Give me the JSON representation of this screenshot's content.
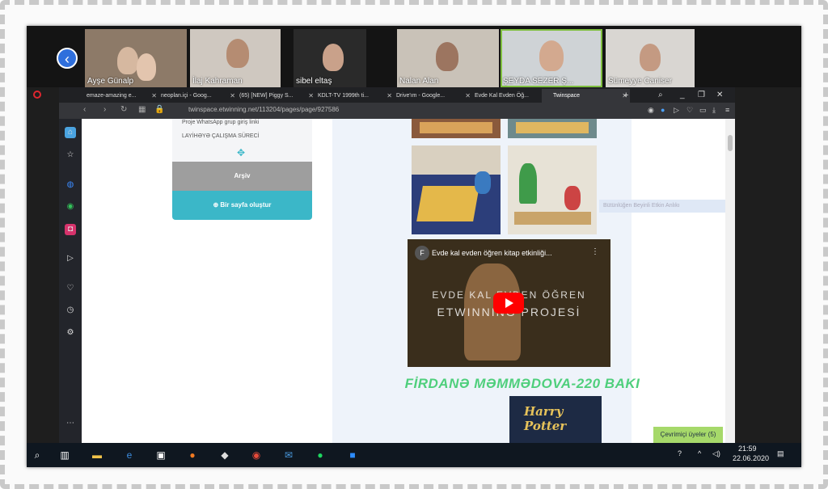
{
  "participants": [
    {
      "name": "Ayşe Günalp"
    },
    {
      "name": "İlaj Kahraman"
    },
    {
      "name": "sibel eltaş"
    },
    {
      "name": "Nalan Alan"
    },
    {
      "name": "ŞEYDA SEZER Ş..."
    },
    {
      "name": "Sümeyye Caniser"
    }
  ],
  "browser": {
    "tabs": [
      {
        "label": "emaze-amazing e..."
      },
      {
        "label": "neoplan.içi - Goog..."
      },
      {
        "label": "(65) [NEW] Piggy S..."
      },
      {
        "label": "KDLT-TV 1999th ti..."
      },
      {
        "label": "Drive'ım - Google..."
      },
      {
        "label": "Evde Kal Evden Öğ..."
      },
      {
        "label": "Twinspace"
      }
    ],
    "new_tab": "+",
    "url": "twinspace.etwinning.net/113204/pages/page/927586"
  },
  "panel": {
    "line1": "Proje WhatsApp grup giriş linki",
    "line2": "LAYİHƏYƏ ÇALIŞMA SÜRECİ",
    "archive": "Arşiv",
    "new_page": "Bir sayfa oluştur"
  },
  "video": {
    "channel_letter": "F",
    "title": "Evde kal evden öğren kitap etkinliği...",
    "overlay_line1": "EVDE KAL EVDEN ÖĞREN",
    "overlay_line2": "ETWINNING PROJESİ"
  },
  "heading": "FİRDANƏ MƏMMƏDOVA-220 BAKI",
  "hp_title": "Harry Potter",
  "hint_text": "Bütünlüğen Beyinli Etkin Anlıkı",
  "online_users": "Çevrimiçi üyeler (5)",
  "taskbar": {
    "time": "21:59",
    "date": "22.06.2020"
  },
  "colors": {
    "accent": "#3bb7c8",
    "heading": "#4fcf7c",
    "online_badge": "#a6d96a"
  }
}
